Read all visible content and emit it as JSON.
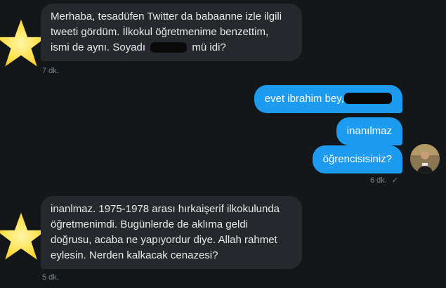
{
  "conversation": {
    "messages": [
      {
        "side": "in",
        "lines": [
          "Merhaba, tesadüfen Twitter da babaanne izle ilgili",
          "tweeti gördüm. İlkokul öğretmenime benzettim,",
          "ismi de aynı. Soyadı"
        ],
        "redacted_tail": "mü idi?",
        "timestamp": "7 dk."
      },
      {
        "side": "out",
        "text": "evet ibrahim bey,",
        "has_redaction": true
      },
      {
        "side": "out",
        "text": "inanılmaz"
      },
      {
        "side": "out",
        "text": "öğrencisisiniz?",
        "timestamp": "6 dk.",
        "status": "✓"
      },
      {
        "side": "in",
        "lines": [
          "inanlmaz. 1975-1978 arası hırkaişerif ilkokulunda",
          "öğretmenimdi. Bugünlerde de aklıma geldi",
          "doğrusu, acaba ne yapıyordur diye. Allah rahmet",
          "eylesin. Nerden kalkacak cenazesi?"
        ],
        "timestamp": "5 dk."
      }
    ]
  },
  "colors": {
    "background": "#14171a",
    "incoming_bubble": "#25292e",
    "outgoing_bubble": "#1d9bf0",
    "star": "#ffe14d"
  },
  "icons": [
    "star-avatar-icon",
    "user-avatar",
    "read-check-icon"
  ]
}
